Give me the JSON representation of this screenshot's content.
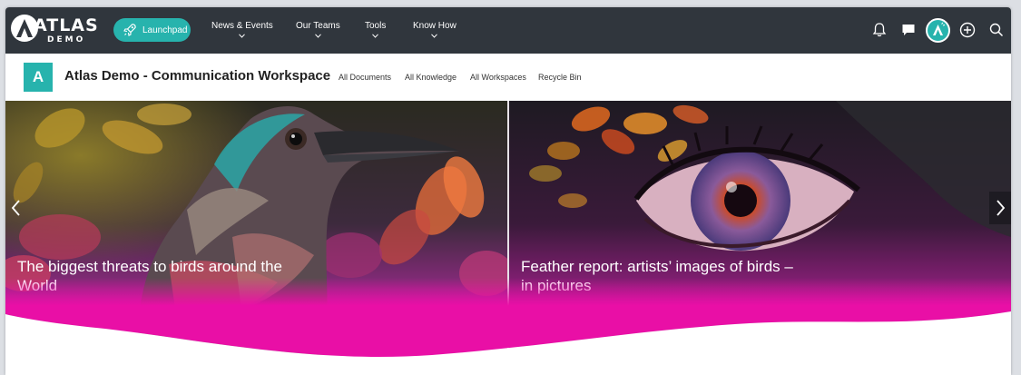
{
  "brand": {
    "title": "ATLAS",
    "subtitle": "DEMO"
  },
  "topnav": {
    "launchpad_label": "Launchpad",
    "items": [
      {
        "label": "News & Events"
      },
      {
        "label": "Our Teams"
      },
      {
        "label": "Tools"
      },
      {
        "label": "Know How"
      }
    ],
    "icons": [
      "bell-icon",
      "chat-icon",
      "user-avatar",
      "add-circle-icon",
      "search-icon"
    ]
  },
  "site": {
    "logo_letter": "A",
    "title": "Atlas Demo - Communication Workspace",
    "links": [
      "All Documents",
      "All Knowledge",
      "All Workspaces",
      "Recycle Bin"
    ]
  },
  "hero": {
    "slides": [
      {
        "title": "The biggest threats to birds around the World"
      },
      {
        "title": "Feather report: artists’ images of birds – in pictures"
      }
    ]
  },
  "colors": {
    "topbar": "#30363d",
    "accent": "#27b3ad",
    "magenta": "#e90fa6"
  }
}
